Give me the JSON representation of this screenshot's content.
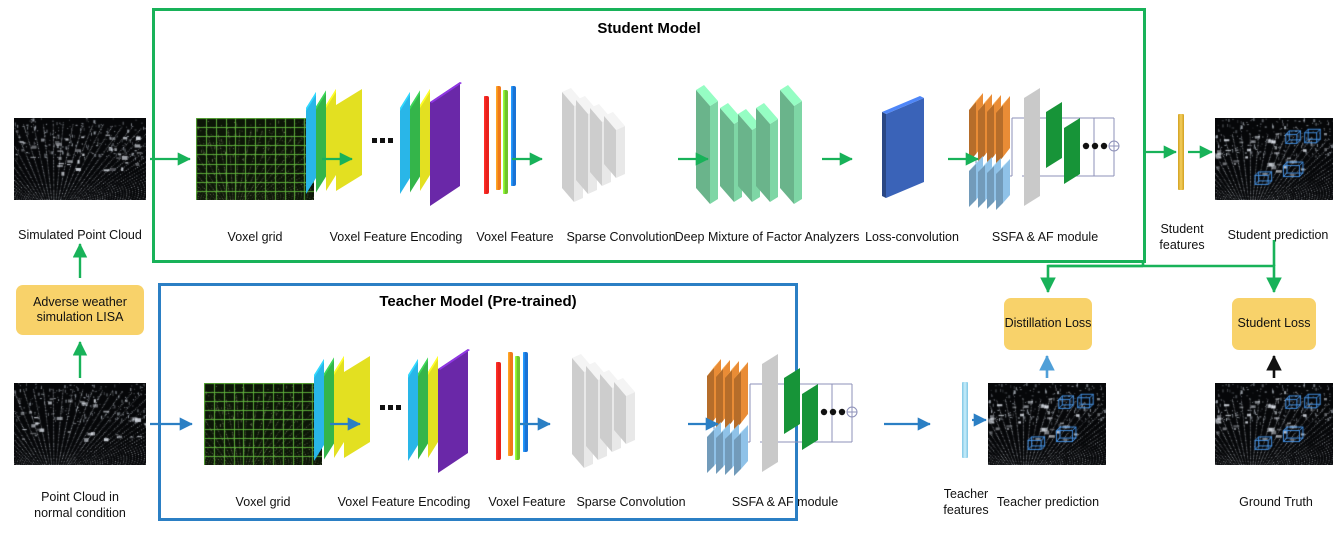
{
  "figure": {
    "type": "architecture-diagram",
    "title": "Knowledge distillation pipeline for 3D object detection in adverse weather"
  },
  "student_box": {
    "title": "Student Model",
    "border_color": "#18b259"
  },
  "teacher_box": {
    "title": "Teacher Model (Pre-trained)",
    "border_color": "#2b7fc4"
  },
  "inputs": {
    "simulated": {
      "label": "Simulated Point Cloud"
    },
    "normal": {
      "label": "Point Cloud in\nnormal condition"
    }
  },
  "lisa": {
    "label": "Adverse weather\nsimulation LISA",
    "color": "#f8d26a"
  },
  "student_stages": [
    {
      "id": "voxel-grid",
      "label": "Voxel grid"
    },
    {
      "id": "voxel-feature-encoding",
      "label": "Voxel Feature Encoding"
    },
    {
      "id": "voxel-feature",
      "label": "Voxel Feature"
    },
    {
      "id": "sparse-convolution",
      "label": "Sparse Convolution"
    },
    {
      "id": "deep-mixture-of-factor-analyzers",
      "label": "Deep Mixture of Factor Analyzers"
    },
    {
      "id": "loss-convolution",
      "label": "Loss-convolution"
    },
    {
      "id": "ssfa-af-module",
      "label": "SSFA & AF module"
    }
  ],
  "teacher_stages": [
    {
      "id": "voxel-grid",
      "label": "Voxel grid"
    },
    {
      "id": "voxel-feature-encoding",
      "label": "Voxel Feature Encoding"
    },
    {
      "id": "voxel-feature",
      "label": "Voxel Feature"
    },
    {
      "id": "sparse-convolution",
      "label": "Sparse Convolution"
    },
    {
      "id": "ssfa-af-module",
      "label": "SSFA & AF module"
    }
  ],
  "student_features": {
    "label": "Student\nfeatures",
    "color": "#e8b631"
  },
  "teacher_features": {
    "label": "Teacher\nfeatures",
    "color": "#9fd8ee"
  },
  "student_prediction": {
    "label": "Student prediction"
  },
  "teacher_prediction": {
    "label": "Teacher prediction"
  },
  "ground_truth": {
    "label": "Ground Truth"
  },
  "losses": [
    {
      "id": "distillation-loss",
      "label": "Distillation\nLoss"
    },
    {
      "id": "student-loss",
      "label": "Student\nLoss"
    }
  ],
  "colors": {
    "student_flow": "#18b259",
    "teacher_flow": "#2b7fc4",
    "gt_flow": "#111111",
    "vfe_cyan": "#29b6e8",
    "vfe_green": "#34b54a",
    "vfe_yellow": "#e3e021",
    "vfe_purple": "#6a28a8",
    "feature_red": "#e8211c",
    "feature_orange": "#ef7a1a",
    "feature_green": "#6fc42a",
    "feature_blue": "#1a72d4",
    "sparse_gray": "#dcdcdc",
    "dmfa_green": "#7ed6a5",
    "lossconv_blue": "#3a63b8",
    "ssfa_orange": "#e98c36",
    "ssfa_blue": "#8fc2e8",
    "ssfa_gray": "#c9c9c9",
    "ssfa_darkgreen": "#179438"
  },
  "ellipsis": "•••"
}
